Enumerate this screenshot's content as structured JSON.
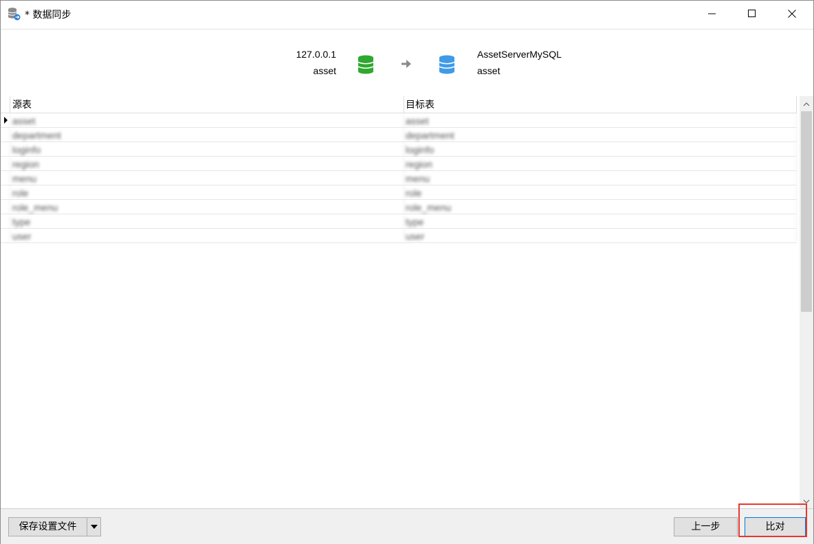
{
  "window": {
    "title": "* 数据同步"
  },
  "source": {
    "host": "127.0.0.1",
    "database": "asset",
    "icon_color": "#2fa82f"
  },
  "target": {
    "host": "AssetServerMySQL",
    "database": "asset",
    "icon_color": "#3f9be8"
  },
  "grid": {
    "columns": [
      "源表",
      "目标表"
    ],
    "rows": [
      {
        "source": "asset",
        "target": "asset",
        "blurred": true
      },
      {
        "source": "department",
        "target": "department",
        "blurred": true
      },
      {
        "source": "loginfo",
        "target": "loginfo",
        "blurred": true
      },
      {
        "source": "region",
        "target": "region",
        "blurred": true
      },
      {
        "source": "menu",
        "target": "menu",
        "blurred": true
      },
      {
        "source": "role",
        "target": "role",
        "blurred": true
      },
      {
        "source": "role_menu",
        "target": "role_menu",
        "blurred": true
      },
      {
        "source": "type",
        "target": "type",
        "blurred": true
      },
      {
        "source": "user",
        "target": "user",
        "blurred": true
      }
    ],
    "active_row": 0
  },
  "footer": {
    "save_label": "保存设置文件",
    "prev_label": "上一步",
    "compare_label": "比对"
  },
  "highlight_color": "#e8362d"
}
